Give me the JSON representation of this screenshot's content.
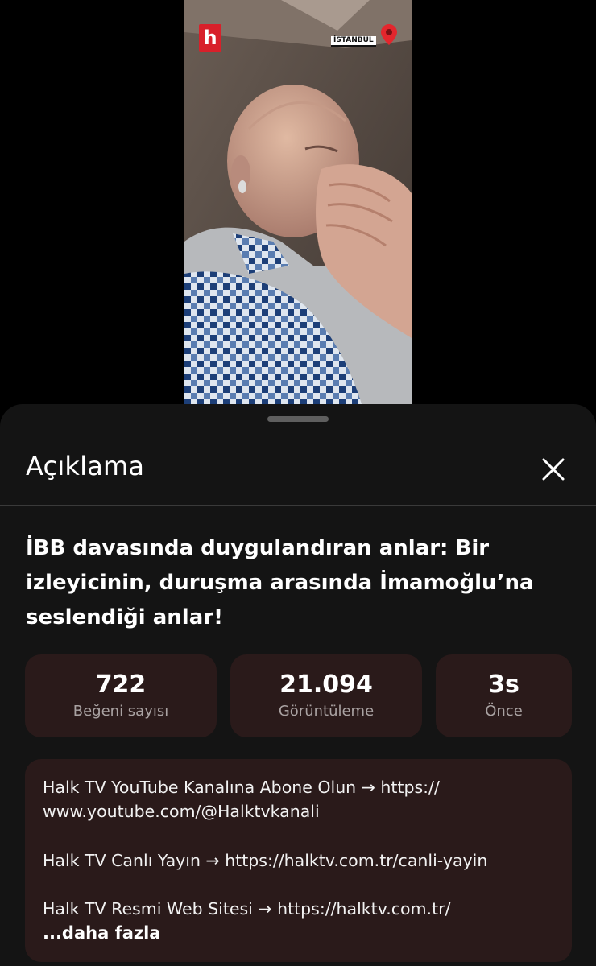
{
  "video": {
    "logo_text": "h",
    "location_tag": "İSTANBUL"
  },
  "sheet": {
    "heading": "Açıklama",
    "title": "İBB davasında duygulandıran anlar: Bir izleyicinin, duruşma arasında İmamoğlu’na seslendiği anlar!",
    "stats": [
      {
        "value": "722",
        "label": "Beğeni sayısı"
      },
      {
        "value": "21.094",
        "label": "Görüntüleme"
      },
      {
        "value": "3s",
        "label": "Önce"
      }
    ],
    "description": {
      "lines": [
        "Halk TV YouTube Kanalına Abone Olun → https://",
        "www.youtube.com/@Halktvkanali",
        "Halk TV Canlı Yayın → https://halktv.com.tr/canli-yayin",
        "Halk TV Resmi Web Sitesi → https://halktv.com.tr/"
      ],
      "more_label": "...daha fazla"
    }
  },
  "colors": {
    "sheet_bg": "#141414",
    "card_bg": "#2a1a1a",
    "logo_red": "#d8202a",
    "muted_text": "#a9a2a2"
  }
}
